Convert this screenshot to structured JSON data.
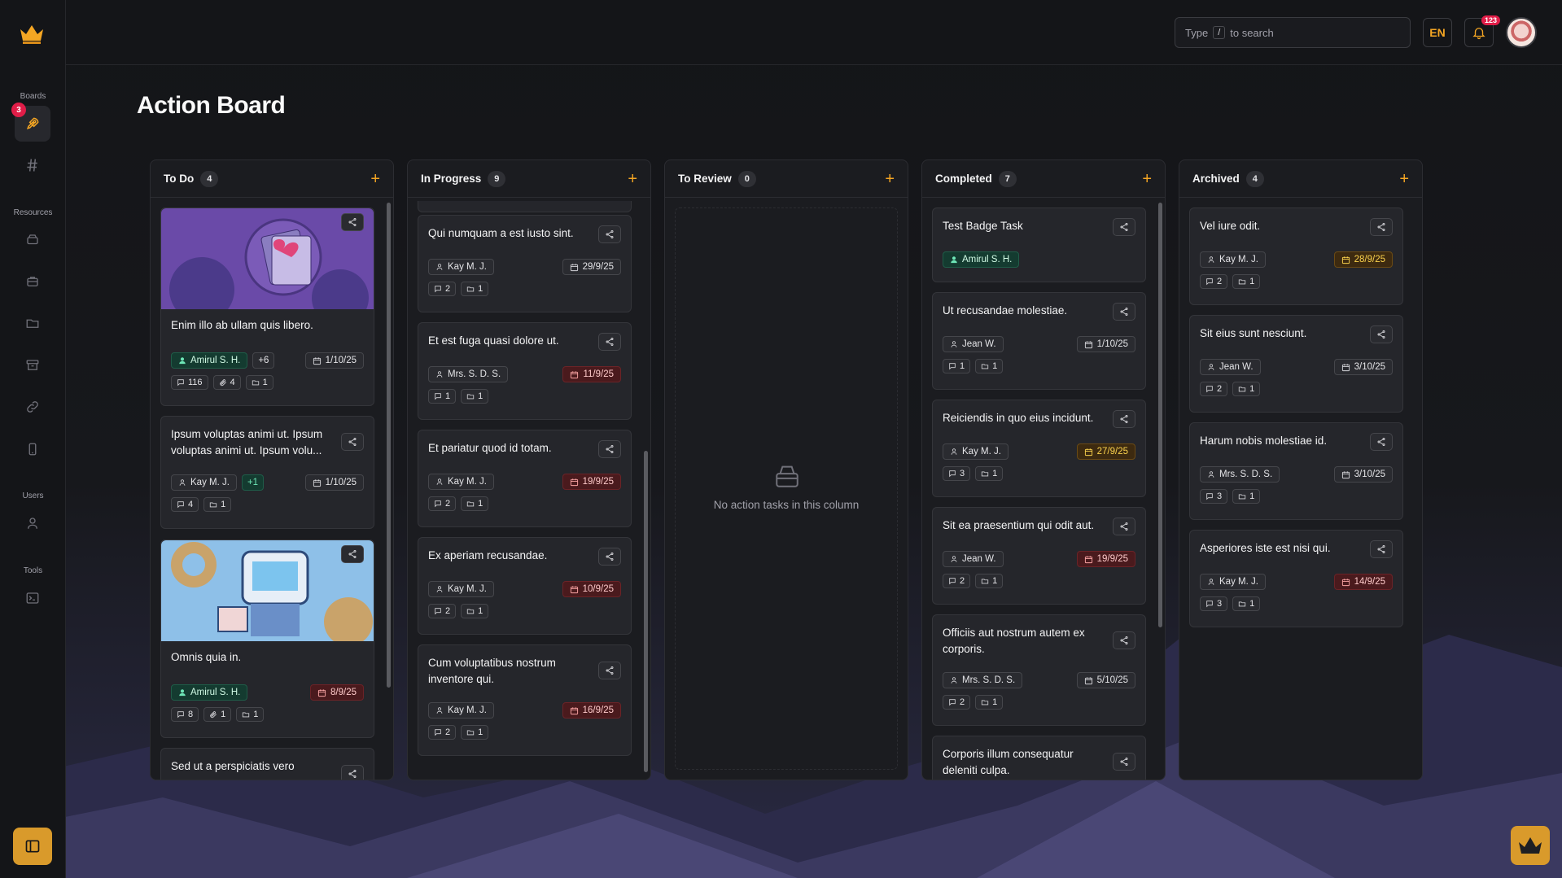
{
  "app": {
    "logo": "crown-logo-icon"
  },
  "sidebar": {
    "sections": [
      {
        "label": "Boards"
      },
      {
        "label": "Resources"
      },
      {
        "label": "Users"
      },
      {
        "label": "Tools"
      }
    ],
    "boards_badge": "3"
  },
  "header": {
    "search_prefix": "Type",
    "search_key": "/",
    "search_suffix": "to search",
    "language": "EN",
    "notifications_count": "123"
  },
  "page": {
    "title": "Action Board"
  },
  "columns": [
    {
      "title": "To Do",
      "count": "4",
      "cards": [
        {
          "title": "Enim illo ab ullam quis libero.",
          "assignee": "Amirul S. H.",
          "extra": "+6",
          "date": "1/10/25",
          "comments": "116",
          "attachments": "4",
          "folders": "1"
        },
        {
          "title": "Ipsum voluptas animi ut. Ipsum voluptas animi ut. Ipsum volu...",
          "assignee": "Kay M. J.",
          "extra": "+1",
          "date": "1/10/25",
          "comments": "4",
          "folders": "1"
        },
        {
          "title": "Omnis quia in.",
          "assignee": "Amirul S. H.",
          "date": "8/9/25",
          "comments": "8",
          "attachments": "1",
          "folders": "1"
        },
        {
          "title": "Sed ut a perspiciatis vero"
        }
      ]
    },
    {
      "title": "In Progress",
      "count": "9",
      "cards": [
        {
          "title": "Qui numquam a est iusto sint.",
          "assignee": "Kay M. J.",
          "date": "29/9/25",
          "comments": "2",
          "folders": "1"
        },
        {
          "title": "Et est fuga quasi dolore ut.",
          "assignee": "Mrs. S. D. S.",
          "date": "11/9/25",
          "comments": "1",
          "folders": "1"
        },
        {
          "title": "Et pariatur quod id totam.",
          "assignee": "Kay M. J.",
          "date": "19/9/25",
          "comments": "2",
          "folders": "1"
        },
        {
          "title": "Ex aperiam recusandae.",
          "assignee": "Kay M. J.",
          "date": "10/9/25",
          "comments": "2",
          "folders": "1"
        },
        {
          "title": "Cum voluptatibus nostrum inventore qui.",
          "assignee": "Kay M. J.",
          "date": "16/9/25",
          "comments": "2",
          "folders": "1"
        }
      ]
    },
    {
      "title": "To Review",
      "count": "0",
      "empty_text": "No action tasks in this column"
    },
    {
      "title": "Completed",
      "count": "7",
      "cards": [
        {
          "title": "Test Badge Task",
          "assignee": "Amirul S. H."
        },
        {
          "title": "Ut recusandae molestiae.",
          "assignee": "Jean W.",
          "date": "1/10/25",
          "comments": "1",
          "folders": "1"
        },
        {
          "title": "Reiciendis in quo eius incidunt.",
          "assignee": "Kay M. J.",
          "date": "27/9/25",
          "comments": "3",
          "folders": "1"
        },
        {
          "title": "Sit ea praesentium qui odit aut.",
          "assignee": "Jean W.",
          "date": "19/9/25",
          "comments": "2",
          "folders": "1"
        },
        {
          "title": "Officiis aut nostrum autem ex corporis.",
          "assignee": "Mrs. S. D. S.",
          "date": "5/10/25",
          "comments": "2",
          "folders": "1"
        },
        {
          "title": "Corporis illum consequatur deleniti culpa."
        }
      ]
    },
    {
      "title": "Archived",
      "count": "4",
      "cards": [
        {
          "title": "Vel iure odit.",
          "assignee": "Kay M. J.",
          "date": "28/9/25",
          "comments": "2",
          "folders": "1"
        },
        {
          "title": "Sit eius sunt nesciunt.",
          "assignee": "Jean W.",
          "date": "3/10/25",
          "comments": "2",
          "folders": "1"
        },
        {
          "title": "Harum nobis molestiae id.",
          "assignee": "Mrs. S. D. S.",
          "date": "3/10/25",
          "comments": "3",
          "folders": "1"
        },
        {
          "title": "Asperiores iste est nisi qui.",
          "assignee": "Kay M. J.",
          "date": "14/9/25",
          "comments": "3",
          "folders": "1"
        }
      ]
    }
  ],
  "colors": {
    "accent": "#f5a623",
    "overdue": "#6b2327",
    "warning": "#6b4a14",
    "assignee_green": "#1f5c48"
  }
}
